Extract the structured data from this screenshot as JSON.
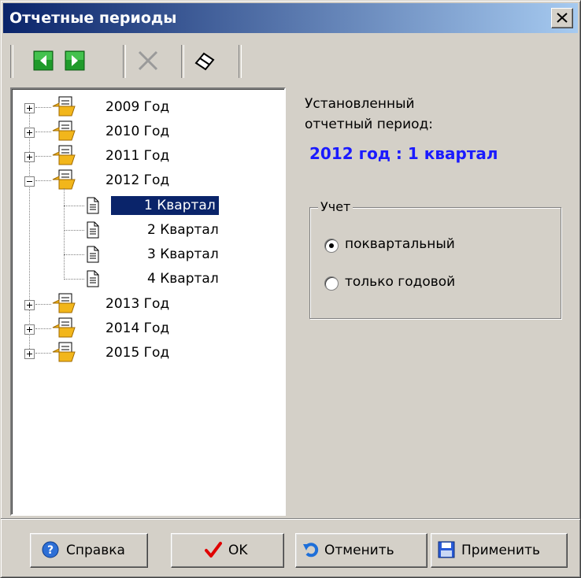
{
  "window": {
    "title": "Отчетные периоды"
  },
  "toolbar": {
    "buttons": [
      {
        "name": "prev-button",
        "icon": "green-left-arrow-icon"
      },
      {
        "name": "next-button",
        "icon": "green-right-arrow-icon"
      },
      {
        "name": "delete-button",
        "icon": "gray-x-icon"
      },
      {
        "name": "edit-button",
        "icon": "eraser-icon"
      }
    ]
  },
  "tree": {
    "items": [
      {
        "label": "2009 Год",
        "expanded": false
      },
      {
        "label": "2010 Год",
        "expanded": false
      },
      {
        "label": "2011 Год",
        "expanded": false
      },
      {
        "label": "2012 Год",
        "expanded": true,
        "children": [
          {
            "label": "1 Квартал",
            "selected": true
          },
          {
            "label": "2 Квартал"
          },
          {
            "label": "3 Квартал"
          },
          {
            "label": "4 Квартал"
          }
        ]
      },
      {
        "label": "2013 Год",
        "expanded": false
      },
      {
        "label": "2014 Год",
        "expanded": false
      },
      {
        "label": "2015 Год",
        "expanded": false
      }
    ]
  },
  "info": {
    "line1": "Установленный",
    "line2": "отчетный период:",
    "period": "2012 год : 1 квартал",
    "period_color": "#1a1aff"
  },
  "accounting": {
    "legend": "Учет",
    "options": [
      {
        "label": "поквартальный",
        "checked": true
      },
      {
        "label": "только годовой",
        "checked": false
      }
    ]
  },
  "buttons": {
    "help": "Справка",
    "ok": "OK",
    "cancel": "Отменить",
    "apply": "Применить"
  }
}
